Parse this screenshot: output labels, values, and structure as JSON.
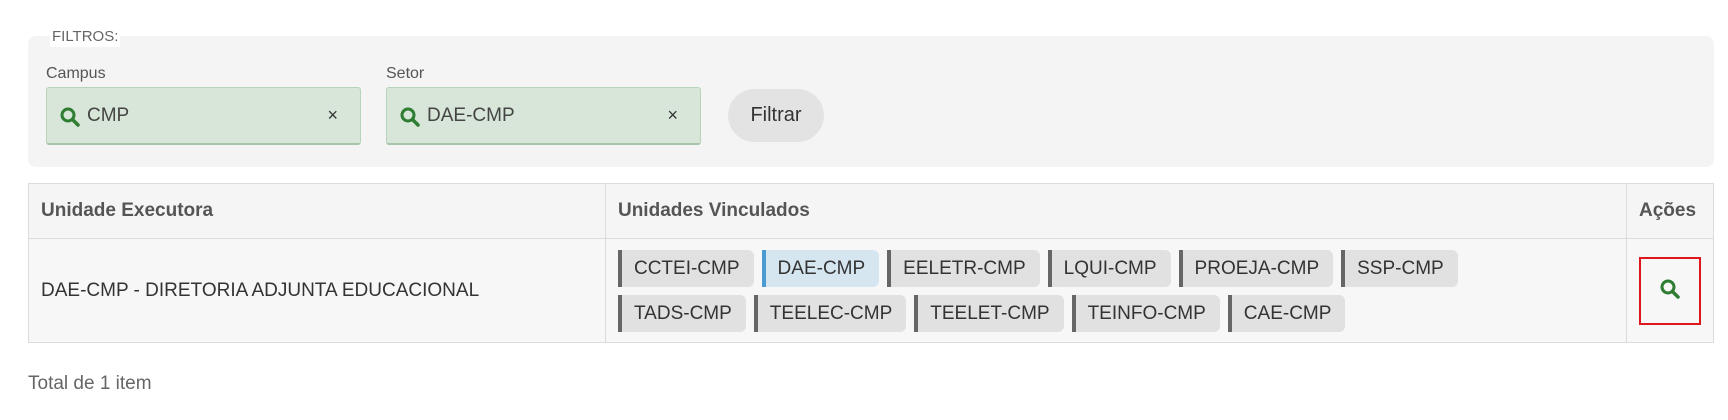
{
  "filters": {
    "title": "FILTROS:",
    "campus": {
      "label": "Campus",
      "value": "CMP",
      "clear": "×"
    },
    "setor": {
      "label": "Setor",
      "value": "DAE-CMP",
      "clear": "×"
    },
    "button_label": "Filtrar",
    "accent_color": "#2e7d32",
    "field_bg_color": "#d8e6d9"
  },
  "table": {
    "headers": [
      "Unidade Executora",
      "Unidades Vinculados",
      "Ações"
    ],
    "rows": [
      {
        "unidade_executora": "DAE-CMP - DIRETORIA ADJUNTA EDUCACIONAL",
        "unidades_vinculados": [
          "CCTEI-CMP",
          "DAE-CMP",
          "EELETR-CMP",
          "LQUI-CMP",
          "PROEJA-CMP",
          "SSP-CMP",
          "TADS-CMP",
          "TEELEC-CMP",
          "TEELET-CMP",
          "TEINFO-CMP",
          "CAE-CMP"
        ],
        "active_tag": "DAE-CMP",
        "action_icon": "search-icon"
      }
    ]
  },
  "footer": {
    "total": "Total de 1 item"
  },
  "colors": {
    "highlight_border": "#e0161e",
    "active_tag_bg": "#d6e6f0",
    "active_tag_border": "#4a9bd1"
  }
}
